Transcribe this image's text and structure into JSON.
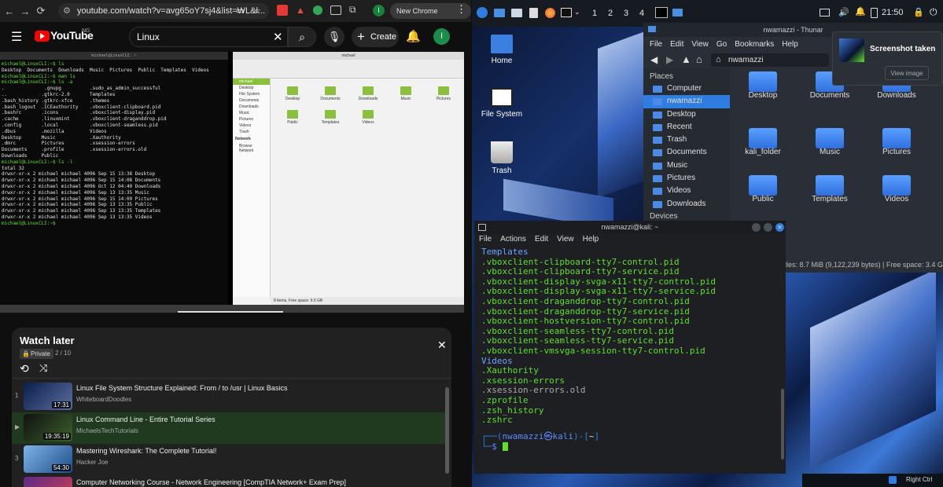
{
  "chrome": {
    "url": "youtube.com/watch?v=avg65oY7sj4&list=WL&i...",
    "update": "New Chrome available",
    "profile": "I"
  },
  "youtube": {
    "logo": "YouTube",
    "region": "NG",
    "search_value": "Linux",
    "create_label": "Create",
    "avatar": "I"
  },
  "video_term": {
    "title": "michael@LinuxCLI: ~",
    "lines": [
      "michael@LinuxCLI:~$ ls",
      "Desktop  Documents  Downloads  Music  Pictures  Public  Templates  Videos",
      "michael@LinuxCLI:~$ man ls",
      "michael@LinuxCLI:~$ ls -a",
      ".              .gnupg          .sudo_as_admin_successful",
      "..            .gtkrc-2.0       Templates",
      ".bash_history .gtkrc-xfce      .themes",
      ".bash_logout  .ICEauthority    .vboxclient-clipboard.pid",
      ".bashrc       .icons           .vboxclient-display.pid",
      ".cache        .linuxmint       .vboxclient-draganddrop.pid",
      ".config       .local           .vboxclient-seamless.pid",
      ".dbus         .mozilla         Videos",
      "Desktop       Music            .Xauthority",
      ".dmrc         Pictures         .xsession-errors",
      "Documents     .profile         .xsession-errors.old",
      "Downloads     Public",
      "michael@LinuxCLI:~$ ls -l",
      "total 32",
      "drwxr-xr-x 2 michael michael 4096 Sep 15 13:38 Desktop",
      "drwxr-xr-x 2 michael michael 4096 Sep 15 14:08 Documents",
      "drwxr-xr-x 2 michael michael 4096 Oct 12 04:40 Downloads",
      "drwxr-xr-x 2 michael michael 4096 Sep 13 13:35 Music",
      "drwxr-xr-x 2 michael michael 4096 Sep 15 14:09 Pictures",
      "drwxr-xr-x 2 michael michael 4096 Sep 13 13:35 Public",
      "drwxr-xr-x 2 michael michael 4096 Sep 13 13:35 Templates",
      "drwxr-xr-x 2 michael michael 4096 Sep 13 13:35 Videos",
      "michael@LinuxCLI:~$"
    ],
    "fm_title": "michael",
    "fm_status": "8 items, Free space: 9.5 GB",
    "fm_places": [
      "michael",
      "Desktop",
      "File System",
      "Documents",
      "Downloads",
      "Music",
      "Pictures",
      "Videos",
      "Trash"
    ],
    "fm_network": "Network",
    "fm_browse": "Browse Network",
    "fm_items": [
      "Desktop",
      "Documents",
      "Downloads",
      "Music",
      "Pictures",
      "Public",
      "Templates",
      "Videos"
    ]
  },
  "watch_later": {
    "title": "Watch later",
    "privacy": "Private",
    "position": "2 / 10",
    "items": [
      {
        "index": "1",
        "title": "Linux File System Structure Explained: From / to /usr | Linux Basics",
        "channel": "WhiteboardDoodles",
        "duration": "17:31"
      },
      {
        "index": "▶",
        "title": "Linux Command Line - Entire Tutorial Series",
        "channel": "MichaelsTechTutorials",
        "duration": "19:35:19"
      },
      {
        "index": "3",
        "title": "Mastering Wireshark: The Complete Tutorial!",
        "channel": "Hacker Joe",
        "duration": "54:30"
      },
      {
        "index": "",
        "title": "Computer Networking Course - Network Engineering [CompTIA Network+ Exam Prep]",
        "channel": "",
        "duration": ""
      }
    ]
  },
  "kali": {
    "panel": {
      "workspaces": [
        "1",
        "2",
        "3",
        "4"
      ],
      "time": "21:50"
    },
    "desktop_icons": [
      "Home",
      "File System",
      "Trash"
    ],
    "thunar": {
      "title": "nwamazzi - Thunar",
      "menu": [
        "File",
        "Edit",
        "View",
        "Go",
        "Bookmarks",
        "Help"
      ],
      "path": "nwamazzi",
      "places_header": "Places",
      "places": [
        "Computer",
        "nwamazzi",
        "Desktop",
        "Recent",
        "Trash",
        "Documents",
        "Music",
        "Pictures",
        "Videos",
        "Downloads"
      ],
      "devices_header": "Devices",
      "items": [
        "Desktop",
        "Documents",
        "Downloads",
        "kali_folder",
        "Music",
        "Pictures",
        "Public",
        "Templates",
        "Videos"
      ],
      "status": "lles: 8.7 MiB (9,122,239 bytes)  |  Free space: 3.4 G"
    },
    "notification": {
      "title": "Screenshot taken",
      "action": "View image"
    },
    "terminal": {
      "title": "nwamazzi@kali: ~",
      "menu": [
        "File",
        "Actions",
        "Edit",
        "View",
        "Help"
      ],
      "lines": [
        {
          "t": "Templates",
          "c": "b"
        },
        {
          "t": ".vboxclient-clipboard-tty7-control.pid",
          "c": "g"
        },
        {
          "t": ".vboxclient-clipboard-tty7-service.pid",
          "c": "g"
        },
        {
          "t": ".vboxclient-display-svga-x11-tty7-control.pid",
          "c": "g"
        },
        {
          "t": ".vboxclient-display-svga-x11-tty7-service.pid",
          "c": "g"
        },
        {
          "t": ".vboxclient-draganddrop-tty7-control.pid",
          "c": "g"
        },
        {
          "t": ".vboxclient-draganddrop-tty7-service.pid",
          "c": "g"
        },
        {
          "t": ".vboxclient-hostversion-tty7-control.pid",
          "c": "g"
        },
        {
          "t": ".vboxclient-seamless-tty7-control.pid",
          "c": "g"
        },
        {
          "t": ".vboxclient-seamless-tty7-service.pid",
          "c": "g"
        },
        {
          "t": ".vboxclient-vmsvga-session-tty7-control.pid",
          "c": "g"
        },
        {
          "t": "Videos",
          "c": "b"
        },
        {
          "t": ".Xauthority",
          "c": "g"
        },
        {
          "t": ".xsession-errors",
          "c": "g"
        },
        {
          "t": ".xsession-errors.old",
          "c": "w"
        },
        {
          "t": ".zprofile",
          "c": "g"
        },
        {
          "t": ".zsh_history",
          "c": "g"
        },
        {
          "t": ".zshrc",
          "c": "g"
        }
      ],
      "prompt_user": "nwamazzi",
      "prompt_host": "kali",
      "prompt_dir": "~"
    },
    "taskbar_right": "Right Ctrl"
  }
}
